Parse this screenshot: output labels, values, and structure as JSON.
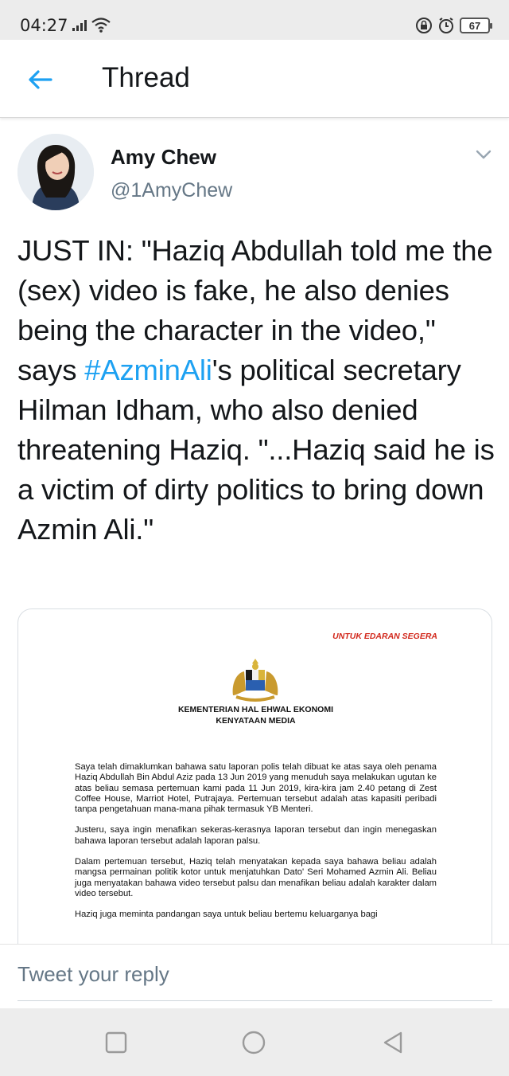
{
  "status_bar": {
    "time": "04:27",
    "battery": "67",
    "icons": [
      "signal-icon",
      "wifi-icon",
      "lock-rotation-icon",
      "alarm-icon",
      "battery-icon"
    ]
  },
  "header": {
    "back_icon": "arrow-left-icon",
    "title": "Thread"
  },
  "tweet": {
    "author_name": "Amy Chew",
    "author_handle": "@1AmyChew",
    "menu_icon": "chevron-down-icon",
    "text_before": "JUST IN: \"Haziq Abdullah told me the (sex) video is fake, he also denies being the character in the video,\" says ",
    "hashtag": "#AzminAli",
    "text_after": "'s political secretary Hilman Idham, who also denied threatening Haziq. \"...Haziq said he is a victim of dirty politics to bring down Azmin Ali.\""
  },
  "document": {
    "urgent_label": "UNTUK EDARAN SEGERA",
    "ministry": "KEMENTERIAN HAL EHWAL EKONOMI",
    "statement_type": "KENYATAAN MEDIA",
    "paragraphs": [
      "Saya telah dimaklumkan bahawa satu laporan polis telah dibuat ke atas saya oleh penama Haziq Abdullah Bin Abdul Aziz pada 13 Jun 2019 yang menuduh saya melakukan ugutan ke atas beliau semasa pertemuan kami pada 11 Jun 2019, kira-kira jam 2.40 petang di Zest Coffee House, Marriot Hotel, Putrajaya. Pertemuan tersebut adalah atas kapasiti peribadi tanpa pengetahuan mana-mana pihak termasuk YB Menteri.",
      "Justeru, saya ingin menafikan sekeras-kerasnya laporan tersebut dan ingin menegaskan bahawa laporan tersebut adalah laporan palsu.",
      "Dalam pertemuan tersebut, Haziq telah menyatakan kepada saya bahawa beliau adalah mangsa permainan politik kotor untuk menjatuhkan Dato' Seri Mohamed Azmin Ali. Beliau juga menyatakan bahawa video tersebut palsu dan menafikan beliau adalah karakter dalam video tersebut.",
      "Haziq juga meminta pandangan saya untuk beliau bertemu keluarganya bagi"
    ]
  },
  "reply": {
    "placeholder": "Tweet your reply"
  },
  "nav": {
    "icons": [
      "recent-apps-icon",
      "home-icon",
      "back-triangle-icon"
    ]
  },
  "colors": {
    "accent": "#1da1f2",
    "text": "#14171a",
    "secondary_text": "#657786",
    "doc_red": "#d2281c"
  }
}
